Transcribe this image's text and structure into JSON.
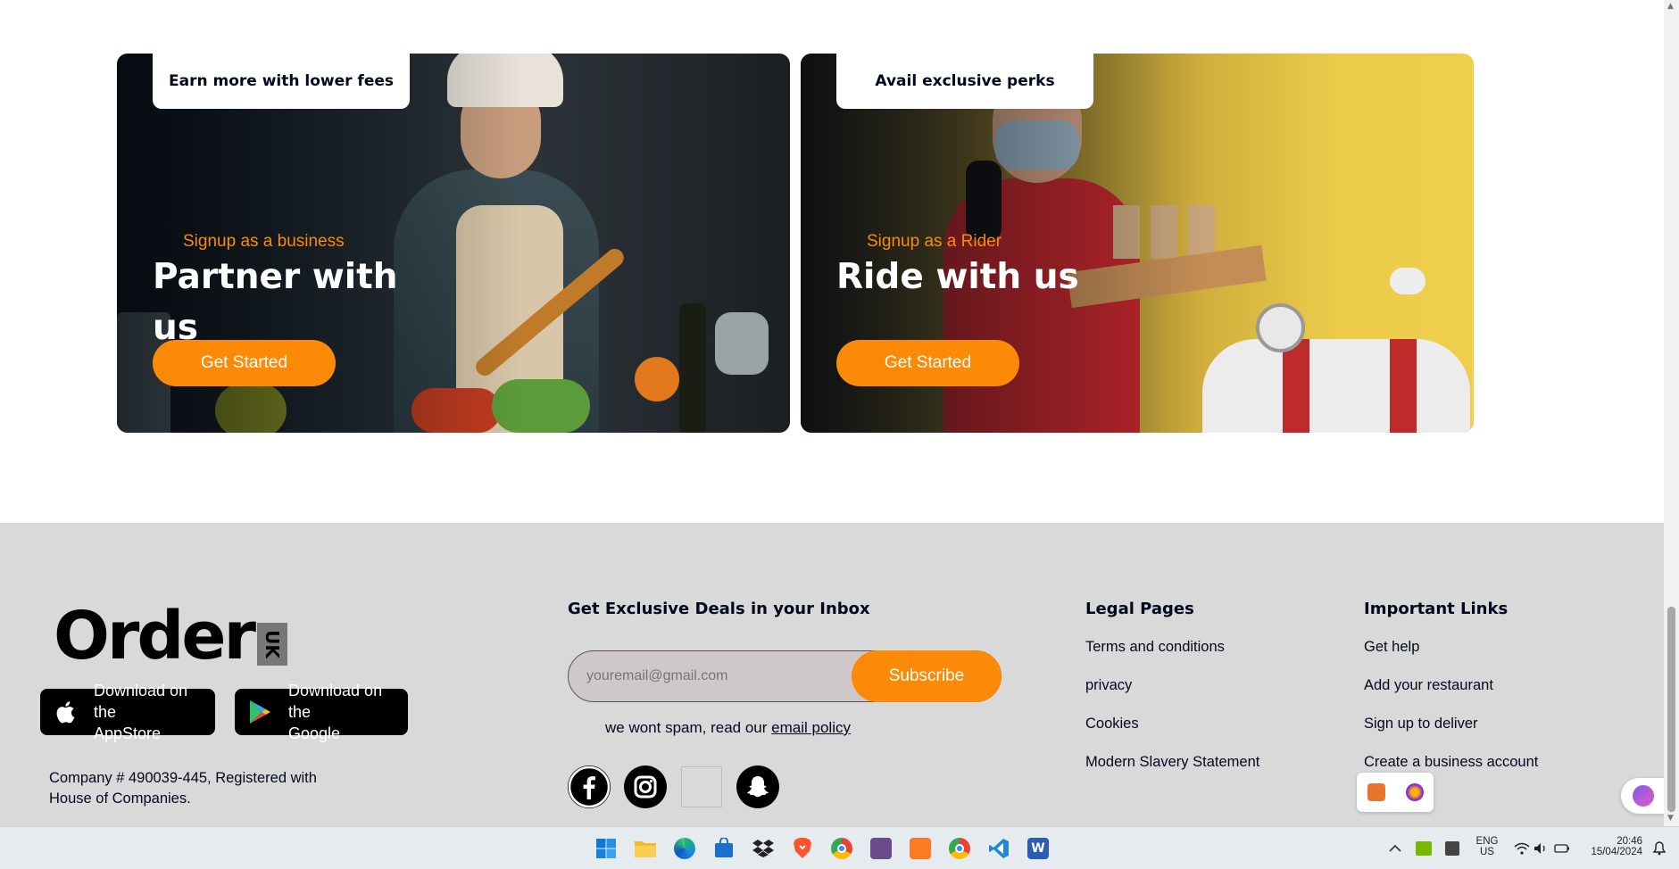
{
  "cards": {
    "partner": {
      "tag": "Earn more with lower fees",
      "subtitle": "Signup as a business",
      "title": "Partner with us",
      "cta": "Get Started"
    },
    "rider": {
      "tag": "Avail exclusive perks",
      "subtitle": "Signup as a Rider",
      "title": "Ride with us",
      "cta": "Get Started"
    }
  },
  "footer": {
    "logo": {
      "text": "Order",
      "badge": "UK"
    },
    "appstore": {
      "line1": "Download on the",
      "line2": "AppStore"
    },
    "google": {
      "line1": "Download on the",
      "line2": "Google"
    },
    "company": "Company # 490039-445, Registered with House of Companies.",
    "newsletter": {
      "title": "Get Exclusive Deals in your Inbox",
      "placeholder": "youremail@gmail.com",
      "button": "Subscribe",
      "nospam_prefix": "we wont spam, read our",
      "nospam_link": "email policy"
    },
    "social": [
      "facebook-icon",
      "instagram-icon",
      "broken-image-icon",
      "snapchat-icon"
    ],
    "legal": {
      "title": "Legal Pages",
      "links": [
        "Terms and conditions",
        "privacy",
        "Cookies",
        "Modern Slavery Statement"
      ]
    },
    "important": {
      "title": "Important Links",
      "links": [
        "Get help",
        "Add your restaurant",
        "Sign up to deliver",
        "Create a business account"
      ]
    }
  },
  "colors": {
    "accent": "#fc8a06",
    "footer_bg": "#d9d9d9",
    "dark_text": "#03081f"
  },
  "taskbar": {
    "icons": [
      "windows-start-icon",
      "file-explorer-icon",
      "edge-icon",
      "store-icon",
      "dropbox-icon",
      "brave-icon",
      "chrome-icon",
      "app-icon",
      "xampp-icon",
      "chrome-profile-icon",
      "vscode-icon",
      "word-icon"
    ],
    "lang_line1": "ENG",
    "lang_line2": "US",
    "time": "20:46",
    "date": "15/04/2024"
  }
}
